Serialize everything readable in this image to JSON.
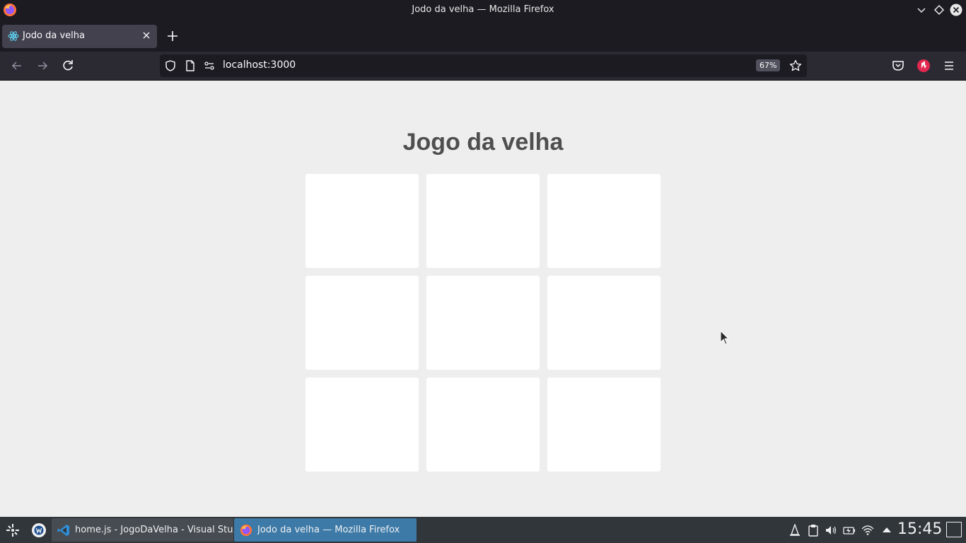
{
  "window": {
    "title": "Jodo da velha — Mozilla Firefox"
  },
  "tab": {
    "label": "Jodo da velha"
  },
  "navbar": {
    "url": "localhost:3000",
    "zoom": "67%"
  },
  "page": {
    "title": "Jogo da velha",
    "board": [
      "",
      "",
      "",
      "",
      "",
      "",
      "",
      "",
      ""
    ]
  },
  "taskbar": {
    "tasks": [
      {
        "label": "home.js - JogoDaVelha - Visual Stu..."
      },
      {
        "label": "Jodo da velha — Mozilla Firefox"
      }
    ],
    "clock": "15:45"
  },
  "colors": {
    "page_bg": "#eeeeee",
    "cell_bg": "#ffffff",
    "title_color": "#4f4f4f",
    "active_task": "#3d7aa8"
  }
}
